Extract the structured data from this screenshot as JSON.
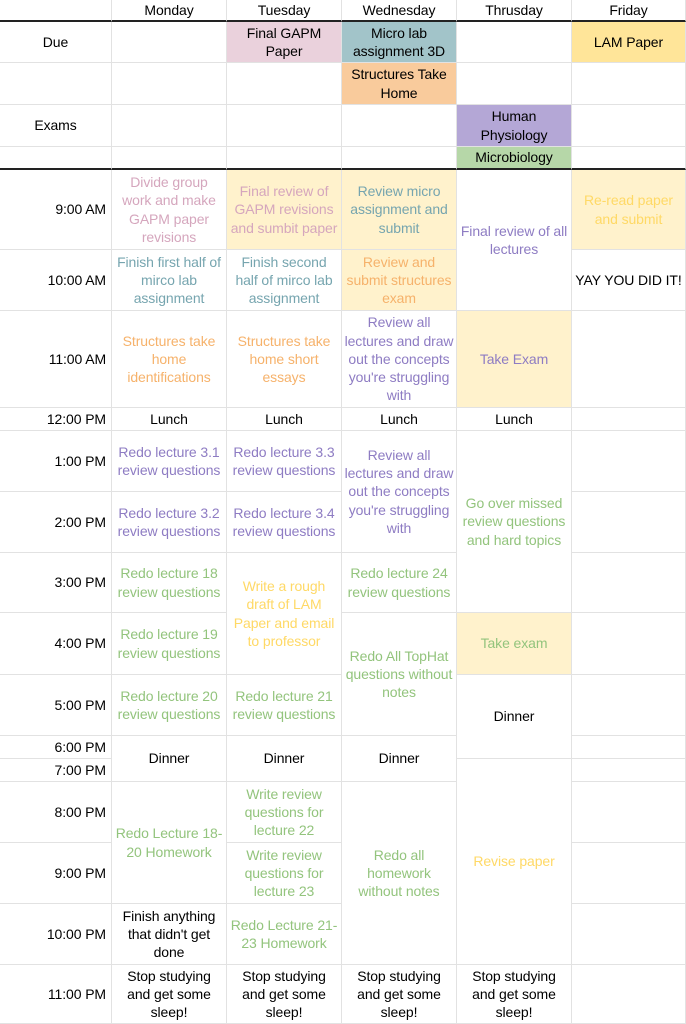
{
  "palette": {
    "pink": "#d5a6bd",
    "pink_bg": "#ead1dc",
    "teal": "#76a5af",
    "teal_bg": "#a2c4c9",
    "orange": "#f6b26b",
    "orange_bg": "#f9cb9c",
    "purple": "#8e7cc3",
    "purple_bg": "#b4a7d6",
    "green": "#93c47d",
    "green_bg": "#b6d7a8",
    "yellow": "#ffd966",
    "yellow_bg": "#ffe599",
    "lightyellow_bg": "#fff2cc",
    "black": "#000000"
  },
  "days": [
    "Monday",
    "Tuesday",
    "Wednesday",
    "Thrusday",
    "Friday"
  ],
  "rows": [
    "Due",
    "",
    "Exams",
    "",
    "9:00 AM",
    "10:00 AM",
    "11:00 AM",
    "12:00 PM",
    "1:00 PM",
    "2:00 PM",
    "3:00 PM",
    "4:00 PM",
    "5:00 PM",
    "6:00 PM",
    "7:00 PM",
    "8:00 PM",
    "9:00 PM",
    "10:00 PM",
    "11:00 PM"
  ],
  "cells": [
    {
      "day": 1,
      "row": 0,
      "span": 1,
      "text": "Final GAPM Paper",
      "color": "black",
      "bg": "pink_bg"
    },
    {
      "day": 2,
      "row": 0,
      "span": 1,
      "text": "Micro lab assignment 3D",
      "color": "black",
      "bg": "teal_bg"
    },
    {
      "day": 4,
      "row": 0,
      "span": 1,
      "text": "LAM Paper",
      "color": "black",
      "bg": "yellow_bg"
    },
    {
      "day": 2,
      "row": 1,
      "span": 1,
      "text": "Structures Take Home",
      "color": "black",
      "bg": "orange_bg"
    },
    {
      "day": 3,
      "row": 2,
      "span": 1,
      "text": "Human Physiology",
      "color": "black",
      "bg": "purple_bg"
    },
    {
      "day": 3,
      "row": 3,
      "span": 1,
      "text": "Microbiology",
      "color": "black",
      "bg": "green_bg"
    },
    {
      "day": 0,
      "row": 4,
      "span": 1,
      "text": "Divide group work and make GAPM paper revisions",
      "color": "pink"
    },
    {
      "day": 0,
      "row": 5,
      "span": 1,
      "text": "Finish first half of mirco lab assignment",
      "color": "teal"
    },
    {
      "day": 0,
      "row": 6,
      "span": 1,
      "text": "Structures take home identifications",
      "color": "orange"
    },
    {
      "day": 0,
      "row": 7,
      "span": 1,
      "text": "Lunch",
      "color": "black"
    },
    {
      "day": 0,
      "row": 8,
      "span": 1,
      "text": "Redo lecture 3.1 review questions",
      "color": "purple"
    },
    {
      "day": 0,
      "row": 9,
      "span": 1,
      "text": "Redo lecture 3.2 review questions",
      "color": "purple"
    },
    {
      "day": 0,
      "row": 10,
      "span": 1,
      "text": "Redo lecture 18 review questions",
      "color": "green"
    },
    {
      "day": 0,
      "row": 11,
      "span": 1,
      "text": "Redo lecture 19 review questions",
      "color": "green"
    },
    {
      "day": 0,
      "row": 12,
      "span": 1,
      "text": "Redo lecture 20 review questions",
      "color": "green"
    },
    {
      "day": 0,
      "row": 13,
      "span": 2,
      "text": "Dinner",
      "color": "black"
    },
    {
      "day": 0,
      "row": 15,
      "span": 2,
      "text": "Redo Lecture 18-20 Homework",
      "color": "green"
    },
    {
      "day": 0,
      "row": 17,
      "span": 1,
      "text": "Finish anything that didn't get done",
      "color": "black"
    },
    {
      "day": 0,
      "row": 18,
      "span": 1,
      "text": "Stop studying and get some sleep!",
      "color": "black"
    },
    {
      "day": 1,
      "row": 4,
      "span": 1,
      "text": "Final review of GAPM revisions and sumbit paper",
      "color": "pink",
      "bg": "lightyellow_bg"
    },
    {
      "day": 1,
      "row": 5,
      "span": 1,
      "text": "Finish second half of mirco lab assignment",
      "color": "teal"
    },
    {
      "day": 1,
      "row": 6,
      "span": 1,
      "text": "Structures take home short essays",
      "color": "orange"
    },
    {
      "day": 1,
      "row": 7,
      "span": 1,
      "text": "Lunch",
      "color": "black"
    },
    {
      "day": 1,
      "row": 8,
      "span": 1,
      "text": "Redo lecture 3.3 review questions",
      "color": "purple"
    },
    {
      "day": 1,
      "row": 9,
      "span": 1,
      "text": "Redo lecture 3.4 review questions",
      "color": "purple"
    },
    {
      "day": 1,
      "row": 10,
      "span": 2,
      "text": "Write a rough draft of LAM Paper and email to professor",
      "color": "yellow"
    },
    {
      "day": 1,
      "row": 12,
      "span": 1,
      "text": "Redo lecture 21 review questions",
      "color": "green"
    },
    {
      "day": 1,
      "row": 13,
      "span": 2,
      "text": "Dinner",
      "color": "black"
    },
    {
      "day": 1,
      "row": 15,
      "span": 1,
      "text": "Write review questions for lecture 22",
      "color": "green"
    },
    {
      "day": 1,
      "row": 16,
      "span": 1,
      "text": "Write review questions for lecture 23",
      "color": "green"
    },
    {
      "day": 1,
      "row": 17,
      "span": 1,
      "text": "Redo Lecture 21-23 Homework",
      "color": "green"
    },
    {
      "day": 1,
      "row": 18,
      "span": 1,
      "text": "Stop studying and get some sleep!",
      "color": "black"
    },
    {
      "day": 2,
      "row": 4,
      "span": 1,
      "text": "Review micro assignment and submit",
      "color": "teal",
      "bg": "lightyellow_bg"
    },
    {
      "day": 2,
      "row": 5,
      "span": 1,
      "text": "Review and submit structures exam",
      "color": "orange",
      "bg": "lightyellow_bg"
    },
    {
      "day": 2,
      "row": 6,
      "span": 1,
      "text": "Review all lectures and draw out the concepts you're struggling with",
      "color": "purple"
    },
    {
      "day": 2,
      "row": 7,
      "span": 1,
      "text": "Lunch",
      "color": "black"
    },
    {
      "day": 2,
      "row": 8,
      "span": 2,
      "text": "Review all lectures and draw out the concepts you're struggling with",
      "color": "purple"
    },
    {
      "day": 2,
      "row": 10,
      "span": 1,
      "text": "Redo lecture 24 review questions",
      "color": "green"
    },
    {
      "day": 2,
      "row": 11,
      "span": 2,
      "text": "Redo All TopHat questions without notes",
      "color": "green"
    },
    {
      "day": 2,
      "row": 13,
      "span": 2,
      "text": "Dinner",
      "color": "black"
    },
    {
      "day": 2,
      "row": 15,
      "span": 3,
      "text": "Redo all homework without notes",
      "color": "green"
    },
    {
      "day": 2,
      "row": 18,
      "span": 1,
      "text": "Stop studying and get some sleep!",
      "color": "black"
    },
    {
      "day": 3,
      "row": 4,
      "span": 2,
      "text": "Final review of all lectures",
      "color": "purple"
    },
    {
      "day": 3,
      "row": 6,
      "span": 1,
      "text": "Take Exam",
      "color": "purple",
      "bg": "lightyellow_bg"
    },
    {
      "day": 3,
      "row": 7,
      "span": 1,
      "text": "Lunch",
      "color": "black"
    },
    {
      "day": 3,
      "row": 8,
      "span": 3,
      "text": "Go over missed review questions and hard topics",
      "color": "green"
    },
    {
      "day": 3,
      "row": 11,
      "span": 1,
      "text": "Take exam",
      "color": "green",
      "bg": "lightyellow_bg"
    },
    {
      "day": 3,
      "row": 12,
      "span": 2,
      "text": "Dinner",
      "color": "black"
    },
    {
      "day": 3,
      "row": 14,
      "span": 4,
      "text": "Revise paper",
      "color": "yellow"
    },
    {
      "day": 3,
      "row": 18,
      "span": 1,
      "text": "Stop studying and get some sleep!",
      "color": "black"
    },
    {
      "day": 4,
      "row": 4,
      "span": 1,
      "text": "Re-read paper and submit",
      "color": "yellow",
      "bg": "lightyellow_bg"
    },
    {
      "day": 4,
      "row": 5,
      "span": 1,
      "text": "YAY YOU DID IT!",
      "color": "black"
    }
  ]
}
